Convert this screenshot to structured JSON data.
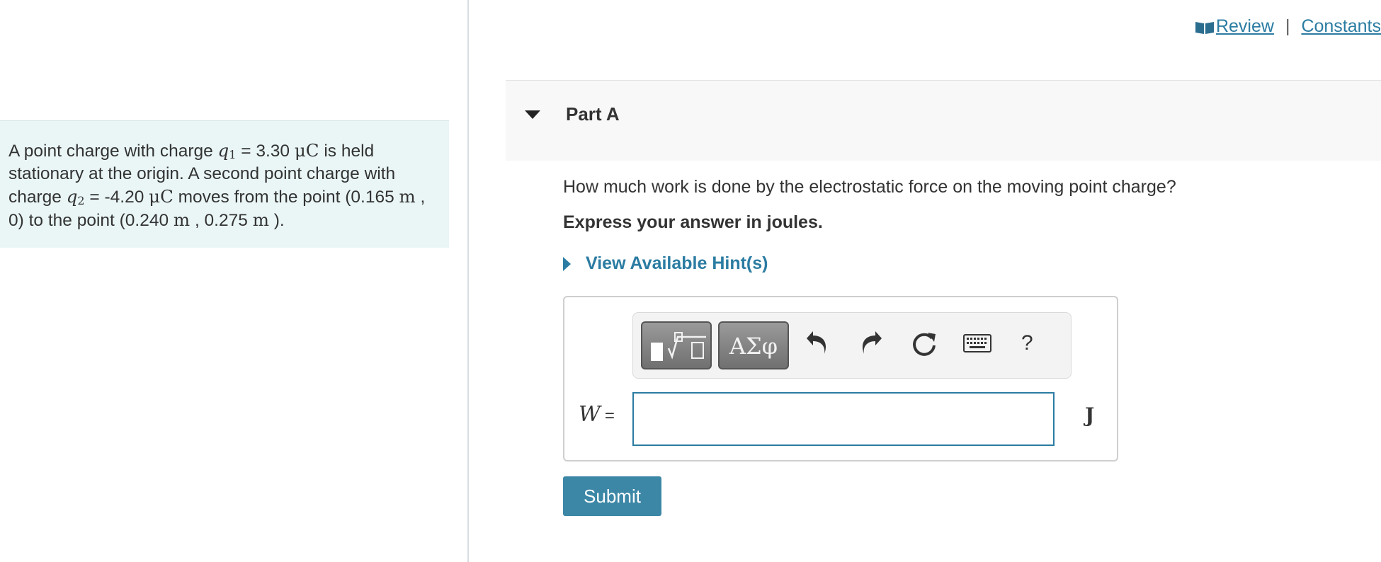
{
  "problem": {
    "t1": "A point charge with charge ",
    "q1_symbol": "q",
    "q1_sub": "1",
    "t2": " = 3.30 ",
    "unit_uC": "μC",
    "t3": " is held stationary at the origin. A second point charge with charge ",
    "q2_symbol": "q",
    "q2_sub": "2",
    "t4": " = -4.20 ",
    "t5": " moves from the point (0.165 ",
    "unit_m": "m",
    "t6": " , 0) to the point (0.240 ",
    "t7": " , 0.275 ",
    "t8": " )."
  },
  "toplinks": {
    "review": "Review",
    "separator": "|",
    "constants": "Constants"
  },
  "part": {
    "title": "Part A",
    "question": "How much work is done by the electrostatic force on the moving point charge?",
    "instruction": "Express your answer in joules.",
    "hint": "View Available Hint(s)"
  },
  "toolbar": {
    "symbols_label": "ΑΣφ",
    "help_label": "?"
  },
  "answer": {
    "variable": "W",
    "equals": "=",
    "value": "",
    "unit": "J"
  },
  "submit_label": "Submit",
  "colors": {
    "accent": "#2b7ca2",
    "problem_bg": "#eaf6f6",
    "submit_bg": "#3d87a6"
  }
}
